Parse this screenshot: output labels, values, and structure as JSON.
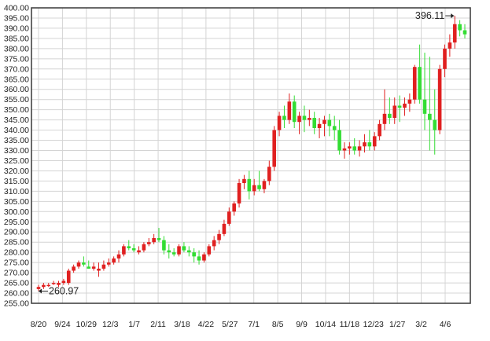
{
  "chart_data": {
    "type": "candlestick",
    "title": "",
    "xlabel": "",
    "ylabel": "",
    "ylim": [
      255,
      400
    ],
    "y_ticks": [
      255,
      260,
      265,
      270,
      275,
      280,
      285,
      290,
      295,
      300,
      305,
      310,
      315,
      320,
      325,
      330,
      335,
      340,
      345,
      350,
      355,
      360,
      365,
      370,
      375,
      380,
      385,
      390,
      395,
      400
    ],
    "y_tick_labels": [
      "255.00",
      "260.00",
      "265.00",
      "270.00",
      "275.00",
      "280.00",
      "285.00",
      "290.00",
      "295.00",
      "300.00",
      "305.00",
      "310.00",
      "315.00",
      "320.00",
      "325.00",
      "330.00",
      "335.00",
      "340.00",
      "345.00",
      "350.00",
      "355.00",
      "360.00",
      "365.00",
      "370.00",
      "375.00",
      "380.00",
      "385.00",
      "390.00",
      "395.00",
      "400.00"
    ],
    "x_tick_labels": [
      "8/20",
      "9/24",
      "10/29",
      "12/3",
      "1/7",
      "2/11",
      "3/18",
      "4/22",
      "5/27",
      "7/1",
      "8/5",
      "9/9",
      "10/14",
      "11/18",
      "12/23",
      "1/27",
      "3/2",
      "4/6"
    ],
    "grid": true,
    "legend": "none",
    "colors": {
      "up": "#e02020",
      "down": "#33dd33",
      "grid": "#d4d4d4",
      "frame": "#444444"
    },
    "annotations": {
      "min": {
        "label": "260.97",
        "value": 260.97
      },
      "max": {
        "label": "396.11",
        "value": 396.11
      }
    },
    "candles": [
      [
        262,
        264,
        261,
        263
      ],
      [
        263,
        265,
        262,
        264
      ],
      [
        264,
        265,
        263,
        264
      ],
      [
        265,
        266,
        264,
        265
      ],
      [
        264,
        266,
        263,
        265
      ],
      [
        265,
        267,
        264,
        266
      ],
      [
        265,
        272,
        264,
        271
      ],
      [
        271,
        274,
        270,
        273
      ],
      [
        273,
        276,
        272,
        275
      ],
      [
        275,
        278,
        273,
        274
      ],
      [
        273,
        276,
        272,
        272
      ],
      [
        272,
        275,
        271,
        273
      ],
      [
        271,
        275,
        268,
        272
      ],
      [
        272,
        276,
        271,
        274
      ],
      [
        274,
        277,
        273,
        275
      ],
      [
        275,
        278,
        274,
        277
      ],
      [
        277,
        281,
        275,
        279
      ],
      [
        279,
        284,
        278,
        283
      ],
      [
        283,
        286,
        281,
        282
      ],
      [
        282,
        284,
        280,
        281
      ],
      [
        280,
        283,
        279,
        281
      ],
      [
        281,
        285,
        280,
        284
      ],
      [
        284,
        287,
        283,
        285
      ],
      [
        285,
        289,
        284,
        287
      ],
      [
        287,
        292,
        285,
        286
      ],
      [
        286,
        288,
        279,
        281
      ],
      [
        281,
        284,
        277,
        280
      ],
      [
        280,
        282,
        278,
        279
      ],
      [
        279,
        284,
        278,
        283
      ],
      [
        283,
        285,
        280,
        281
      ],
      [
        281,
        283,
        278,
        280
      ],
      [
        280,
        282,
        275,
        278
      ],
      [
        278,
        281,
        274,
        276
      ],
      [
        276,
        280,
        275,
        279
      ],
      [
        279,
        284,
        278,
        283
      ],
      [
        283,
        288,
        281,
        286
      ],
      [
        286,
        291,
        284,
        289
      ],
      [
        289,
        296,
        288,
        294
      ],
      [
        294,
        302,
        293,
        300
      ],
      [
        300,
        305,
        298,
        304
      ],
      [
        304,
        316,
        302,
        314
      ],
      [
        314,
        318,
        311,
        316
      ],
      [
        316,
        320,
        306,
        310
      ],
      [
        310,
        316,
        308,
        313
      ],
      [
        313,
        320,
        310,
        311
      ],
      [
        311,
        316,
        309,
        315
      ],
      [
        315,
        325,
        313,
        322
      ],
      [
        322,
        342,
        320,
        340
      ],
      [
        340,
        349,
        337,
        347
      ],
      [
        347,
        352,
        341,
        345
      ],
      [
        345,
        358,
        343,
        354
      ],
      [
        354,
        357,
        341,
        344
      ],
      [
        344,
        349,
        338,
        347
      ],
      [
        347,
        352,
        339,
        345
      ],
      [
        345,
        350,
        342,
        346
      ],
      [
        346,
        349,
        338,
        341
      ],
      [
        341,
        346,
        336,
        343
      ],
      [
        343,
        347,
        337,
        345
      ],
      [
        345,
        348,
        337,
        342
      ],
      [
        342,
        347,
        335,
        340
      ],
      [
        340,
        345,
        328,
        330
      ],
      [
        330,
        334,
        326,
        331
      ],
      [
        331,
        334,
        328,
        332
      ],
      [
        332,
        336,
        328,
        330
      ],
      [
        330,
        335,
        327,
        332
      ],
      [
        332,
        338,
        329,
        334
      ],
      [
        334,
        340,
        330,
        332
      ],
      [
        332,
        339,
        330,
        337
      ],
      [
        337,
        345,
        335,
        343
      ],
      [
        343,
        360,
        340,
        348
      ],
      [
        348,
        356,
        343,
        346
      ],
      [
        346,
        356,
        343,
        352
      ],
      [
        352,
        357,
        344,
        351
      ],
      [
        351,
        356,
        347,
        353
      ],
      [
        353,
        358,
        349,
        355
      ],
      [
        355,
        372,
        353,
        371
      ],
      [
        371,
        382,
        353,
        355
      ],
      [
        355,
        378,
        340,
        348
      ],
      [
        348,
        376,
        330,
        345
      ],
      [
        345,
        360,
        328,
        340
      ],
      [
        340,
        372,
        338,
        370
      ],
      [
        370,
        382,
        366,
        380
      ],
      [
        380,
        387,
        376,
        383
      ],
      [
        383,
        396.11,
        380,
        392
      ],
      [
        392,
        394,
        386,
        389
      ],
      [
        389,
        392,
        385,
        387
      ]
    ]
  }
}
